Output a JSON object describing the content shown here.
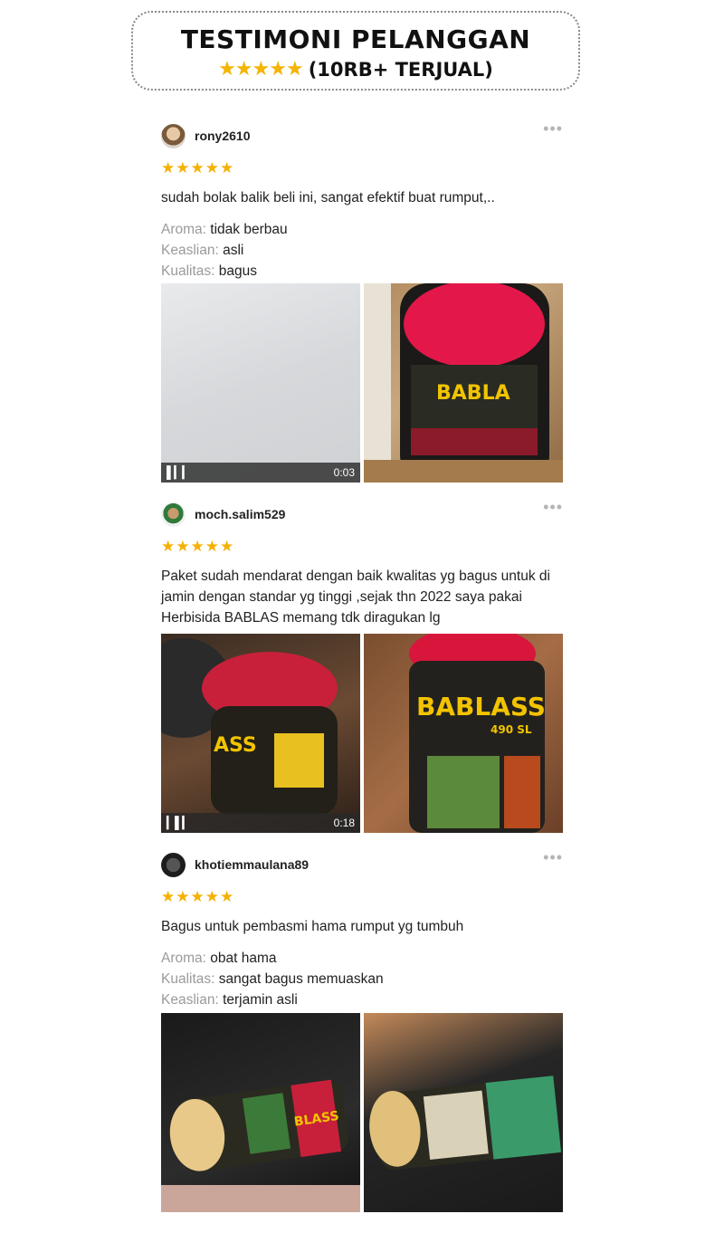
{
  "header": {
    "title": "TESTIMONI PELANGGAN",
    "stars": "★★★★★",
    "sold": "(10RB+ TERJUAL)"
  },
  "reviews": [
    {
      "username": "rony2610",
      "stars": "★★★★★",
      "text": "sudah bolak balik beli ini, sangat efektif buat rumput,..",
      "attributes": [
        {
          "label": "Aroma:",
          "value": "tidak berbau"
        },
        {
          "label": "Keaslian:",
          "value": "asli"
        },
        {
          "label": "Kualitas:",
          "value": "bagus"
        }
      ],
      "video_duration": "0:03",
      "bottle_label": "BABLA"
    },
    {
      "username": "moch.salim529",
      "stars": "★★★★★",
      "text": "Paket sudah mendarat dengan baik  kwalitas yg bagus untuk di jamin dengan standar yg tinggi ,sejak thn 2022 saya pakai Herbisida BABLAS memang tdk diragukan lg",
      "attributes": [],
      "video_duration": "0:18",
      "bottle_label": "BABLASS",
      "bottle_sub": "490 SL",
      "bottle_label_side": "ASS"
    },
    {
      "username": "khotiemmaulana89",
      "stars": "★★★★★",
      "text": "Bagus untuk pembasmi hama rumput yg tumbuh",
      "attributes": [
        {
          "label": "Aroma:",
          "value": "obat hama"
        },
        {
          "label": "Kualitas:",
          "value": "sangat bagus memuaskan"
        },
        {
          "label": "Keaslian:",
          "value": "terjamin asli"
        }
      ],
      "bottle_label": "BLASS"
    }
  ],
  "icons": {
    "more": "more-options-icon",
    "video": "video-audio-icon"
  },
  "colors": {
    "star": "#f5b100",
    "bottle_red": "#d8163c"
  }
}
